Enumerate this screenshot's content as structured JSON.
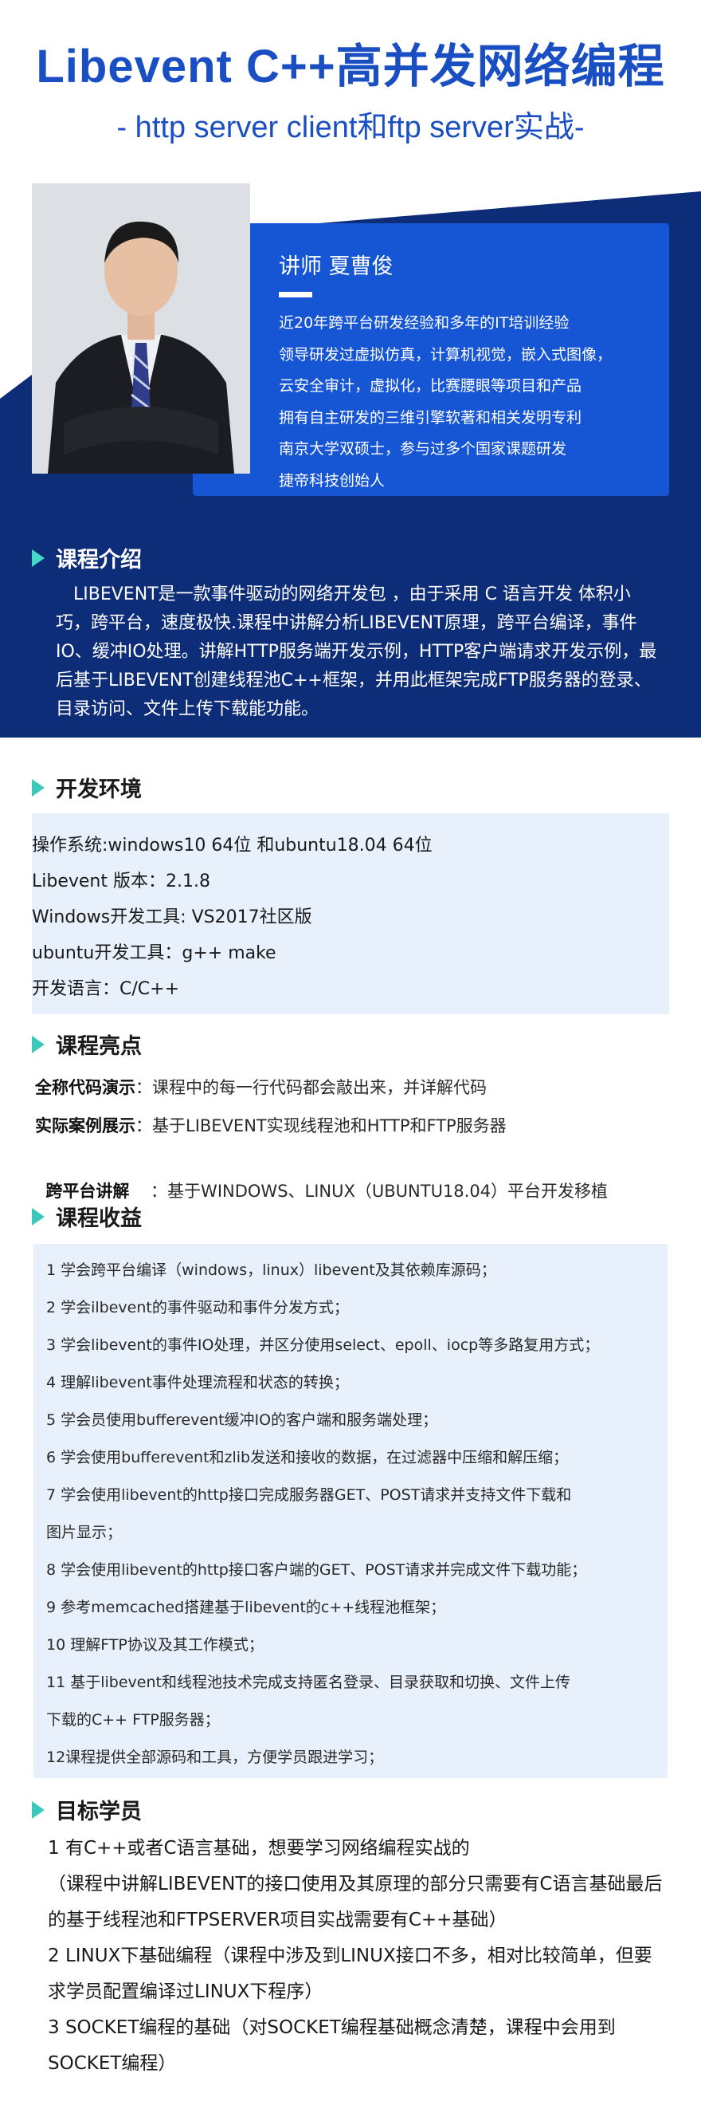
{
  "hero": {
    "title": "Libevent C++高并发网络编程",
    "subtitle": "- http server client和ftp server实战-"
  },
  "teacher": {
    "name": "讲师  夏曹俊",
    "bio": [
      "近20年跨平台研发经验和多年的IT培训经验",
      "领导研发过虚拟仿真，计算机视觉，嵌入式图像，",
      "云安全审计，虚拟化，比赛腰眼等项目和产品",
      "拥有自主研发的三维引擎软著和相关发明专利",
      "南京大学双硕士，参与过多个国家课题研发",
      "捷帝科技创始人"
    ]
  },
  "intro": {
    "heading": "课程介绍",
    "text": "LIBEVENT是一款事件驱动的网络开发包 ，由于采用 C 语言开发 体积小巧，跨平台，速度极快.课程中讲解分析LIBEVENT原理，跨平台编译，事件IO、缓冲IO处理。讲解HTTP服务端开发示例，HTTP客户端请求开发示例，最后基于LIBEVENT创建线程池C++框架，并用此框架完成FTP服务器的登录、目录访问、文件上传下载能功能。"
  },
  "env": {
    "heading": "开发环境",
    "lines": [
      "操作系统:windows10 64位 和ubuntu18.04 64位",
      "Libevent 版本：2.1.8",
      "Windows开发工具: VS2017社区版",
      "ubuntu开发工具：g++ make",
      "开发语言：C/C++"
    ]
  },
  "highlights": {
    "heading": "课程亮点",
    "items": [
      {
        "label": "全称代码演示",
        "text": "：课程中的每一行代码都会敲出来，并详解代码"
      },
      {
        "label": "实际案例展示",
        "text": "：基于LIBEVENT实现线程池和HTTP和FTP服务器"
      },
      {
        "label": "跨平台讲解",
        "text": "    ：基于WINDOWS、LINUX（UBUNTU18.04）平台开发移植"
      }
    ]
  },
  "gains": {
    "heading": "课程收益",
    "lines": [
      " 1 学会跨平台编译（windows，linux）libevent及其依赖库源码；",
      " 2 学会ilbevent的事件驱动和事件分发方式；",
      " 3 学会libevent的事件IO处理，并区分使用select、epoll、iocp等多路复用方式；",
      " 4 理解libevent事件处理流程和状态的转换；",
      " 5 学会员使用bufferevent缓冲IO的客户端和服务端处理；",
      " 6 学会使用bufferevent和zlib发送和接收的数据，在过滤器中压缩和解压缩；",
      " 7 学会使用libevent的http接口完成服务器GET、POST请求并支持文件下载和",
      "图片显示；",
      " 8 学会使用libevent的http接口客户端的GET、POST请求并完成文件下载功能；",
      " 9 参考memcached搭建基于libevent的c++线程池框架；",
      "10 理解FTP协议及其工作模式；",
      "11 基于libevent和线程池技术完成支持匿名登录、目录获取和切换、文件上传",
      "下载的C++ FTP服务器；",
      "12课程提供全部源码和工具，方便学员跟进学习；"
    ]
  },
  "target": {
    "heading": "目标学员",
    "lines": [
      "1 有C++或者C语言基础，想要学习网络编程实战的",
      "（课程中讲解LIBEVENT的接口使用及其原理的部分只需要有C语言基础最后的基于线程池和FTPSERVER项目实战需要有C++基础）",
      "2 LINUX下基础编程（课程中涉及到LINUX接口不多，相对比较简单，但要求学员配置编译过LINUX下程序）",
      "3 SOCKET编程的基础（对SOCKET编程基础概念清楚，课程中会用到SOCKET编程）"
    ]
  },
  "colors": {
    "brand_blue": "#1a4fc4",
    "card_blue": "#1656d4",
    "navy": "#0e2d78",
    "teal_accent": "#3cc9bc",
    "panel_bg": "#e8f0fb"
  }
}
